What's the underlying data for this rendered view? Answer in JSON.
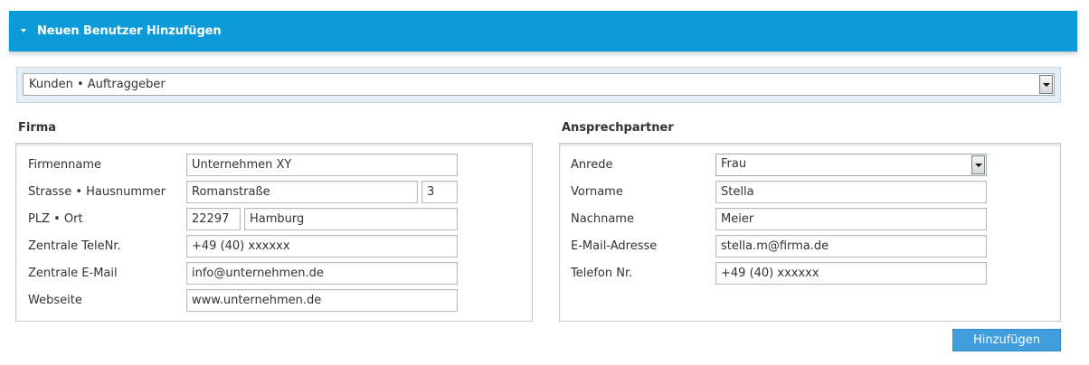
{
  "header": {
    "title": "Neuen Benutzer Hinzufügen",
    "toggle_icon": "caret-down-icon"
  },
  "category": {
    "selected": "Kunden • Auftraggeber"
  },
  "company": {
    "title": "Firma",
    "labels": {
      "name": "Firmenname",
      "street": "Strasse • Hausnummer",
      "city": "PLZ • Ort",
      "phone": "Zentrale TeleNr.",
      "email": "Zentrale E-Mail",
      "website": "Webseite"
    },
    "values": {
      "name": "Unternehmen XY",
      "street": "Romanstraße",
      "house_number": "3",
      "zip": "22297",
      "city": "Hamburg",
      "phone": "+49 (40) xxxxxx",
      "email": "info@unternehmen.de",
      "website": "www.unternehmen.de"
    }
  },
  "contact": {
    "title": "Ansprechpartner",
    "labels": {
      "salutation": "Anrede",
      "first_name": "Vorname",
      "last_name": "Nachname",
      "email": "E-Mail-Adresse",
      "phone": "Telefon Nr."
    },
    "values": {
      "salutation": "Frau",
      "first_name": "Stella",
      "last_name": "Meier",
      "email": "stella.m@firma.de",
      "phone": "+49 (40) xxxxxx"
    }
  },
  "actions": {
    "submit_label": "Hinzufügen"
  },
  "colors": {
    "header_bg": "#0c9bd9",
    "button_bg": "#3f9edb"
  }
}
